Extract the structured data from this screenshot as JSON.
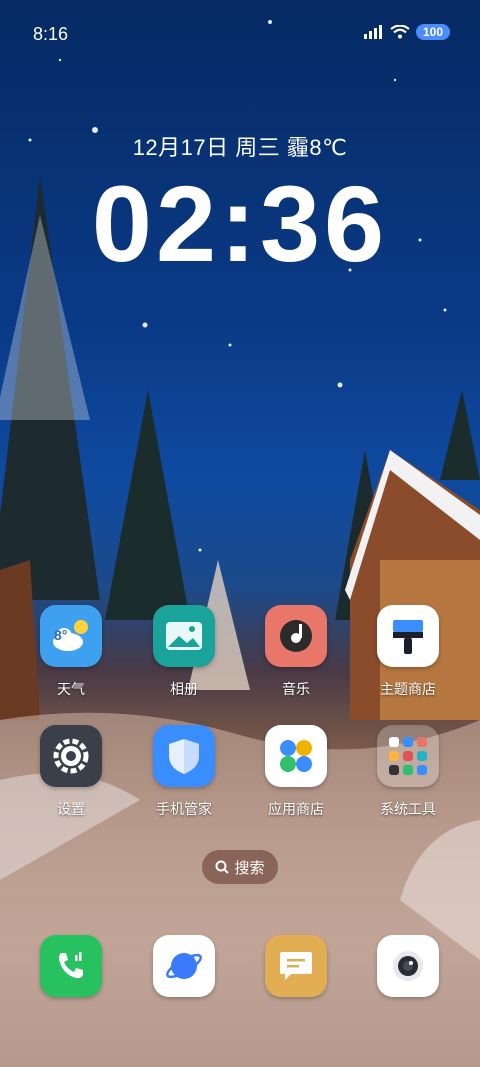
{
  "status": {
    "time": "8:16",
    "battery": "100"
  },
  "lock": {
    "date": "12月17日 周三 霾8℃",
    "clock": "02:36"
  },
  "apps": [
    {
      "label": "天气",
      "badge": "8°",
      "icon": "weather-icon",
      "color": "#3ea1ef"
    },
    {
      "label": "相册",
      "icon": "photo-icon",
      "color": "#19a39b"
    },
    {
      "label": "音乐",
      "icon": "music-icon",
      "color": "#e8776a"
    },
    {
      "label": "主题商店",
      "icon": "brush-icon",
      "color": "#ffffff"
    },
    {
      "label": "设置",
      "icon": "gear-icon",
      "color": "#3b3f49"
    },
    {
      "label": "手机管家",
      "icon": "shield-icon",
      "color": "#3a8dfc"
    },
    {
      "label": "应用商店",
      "icon": "app-store-icon",
      "color": "#ffffff"
    },
    {
      "label": "系统工具",
      "icon": "folder-icon",
      "color": "rgba(255,255,255,0.25)"
    }
  ],
  "search": {
    "label": "搜索"
  },
  "dock": [
    {
      "icon": "phone-icon",
      "color": "#27c25f"
    },
    {
      "icon": "browser-icon",
      "color": "#ffffff"
    },
    {
      "icon": "message-icon",
      "color": "#e3ad54"
    },
    {
      "icon": "camera-icon",
      "color": "#ffffff"
    }
  ]
}
